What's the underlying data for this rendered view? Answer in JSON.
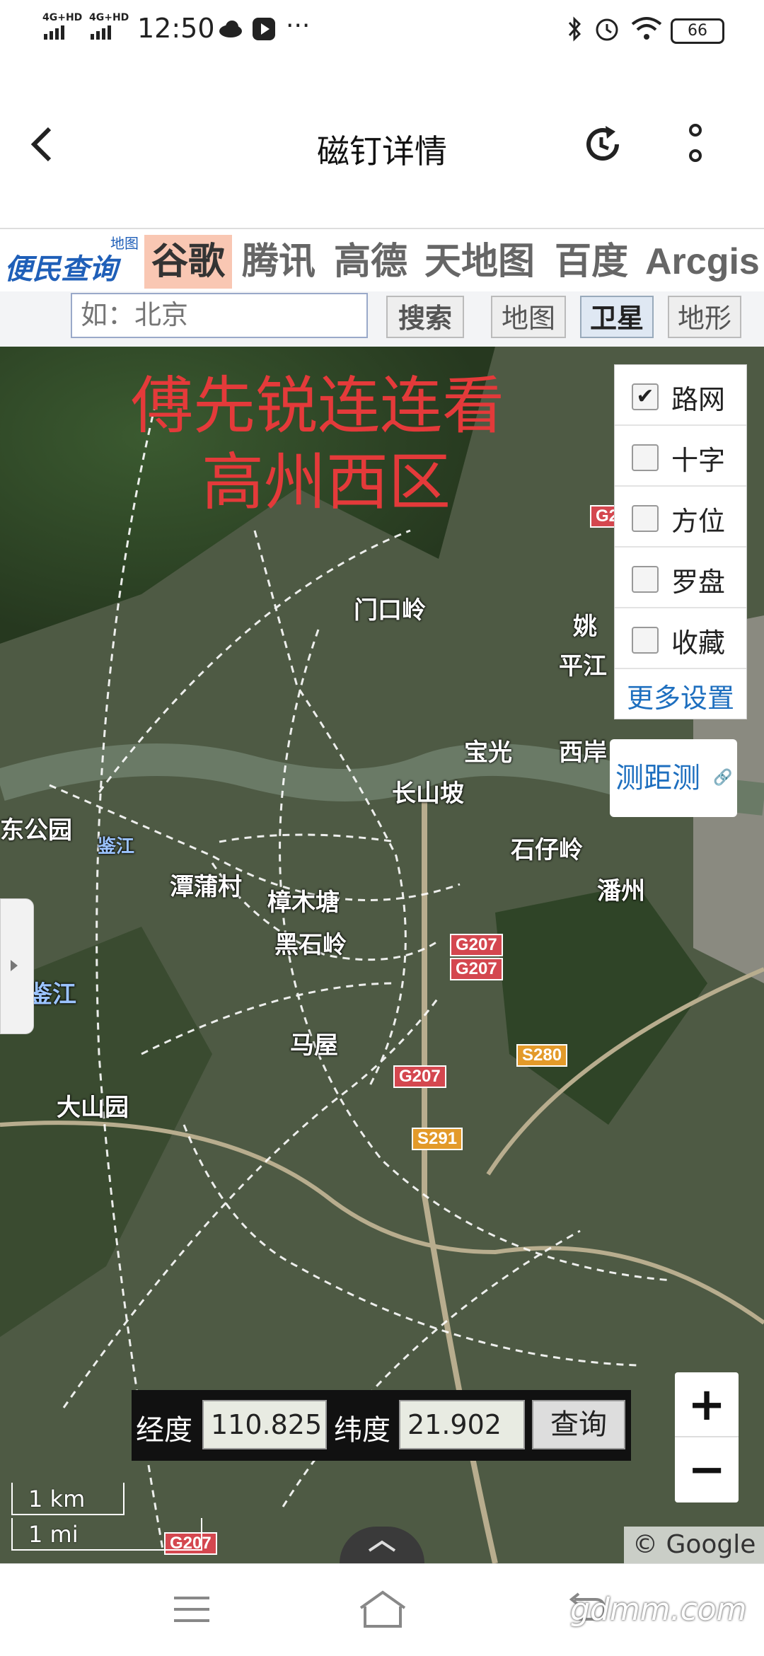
{
  "status": {
    "net1": "4G+HD",
    "net2": "4G+HD",
    "time": "12:50",
    "more": "···",
    "battery": "66"
  },
  "header": {
    "title": "磁钉详情",
    "back_icon": "back-arrow-icon",
    "refresh_icon": "refresh-icon",
    "more_icon": "more-vertical-icon"
  },
  "site": {
    "logo_main": "便民查询网",
    "logo_sub": "地图",
    "tabs": [
      "谷歌",
      "腾讯",
      "高德",
      "天地图",
      "百度",
      "Arcgis"
    ],
    "active_tab": "谷歌",
    "search_placeholder": "如：北京",
    "search_button": "搜索",
    "view_buttons": [
      "地图",
      "卫星",
      "地形"
    ]
  },
  "overlay": {
    "line1": "傅先锐连连看",
    "line2": "高州西区"
  },
  "layers": {
    "items": [
      {
        "label": "路网",
        "checked": true
      },
      {
        "label": "十字",
        "checked": false
      },
      {
        "label": "方位",
        "checked": false
      },
      {
        "label": "罗盘",
        "checked": false
      },
      {
        "label": "收藏",
        "checked": false
      }
    ],
    "more": "更多设置"
  },
  "measure": {
    "label": "测距测"
  },
  "places": [
    "门口岭",
    "姚",
    "平江",
    "宝光",
    "西岸",
    "长山坡",
    "石仔岭",
    "潘州",
    "潭蒲村",
    "樟木塘",
    "黑石岭",
    "鉴江",
    "马屋",
    "大山园",
    "东公园",
    "鉴江"
  ],
  "roads": [
    "G207",
    "G207",
    "G207",
    "G207",
    "S280",
    "S291",
    "G2"
  ],
  "coords": {
    "lng_label": "经度",
    "lng_value": "110.825",
    "lat_label": "纬度",
    "lat_value": "21.902",
    "query": "查询"
  },
  "zoom": {
    "in": "+",
    "out": "−"
  },
  "scale": {
    "km": "1 km",
    "mi": "1 mi"
  },
  "copyright": "© Google",
  "watermark": "gdmm.com",
  "colors": {
    "overlay_text": "#e43a3a",
    "link": "#1e6fbf",
    "road_shield": "#d4474f",
    "active_tab_bg": "#f9c7b3"
  }
}
